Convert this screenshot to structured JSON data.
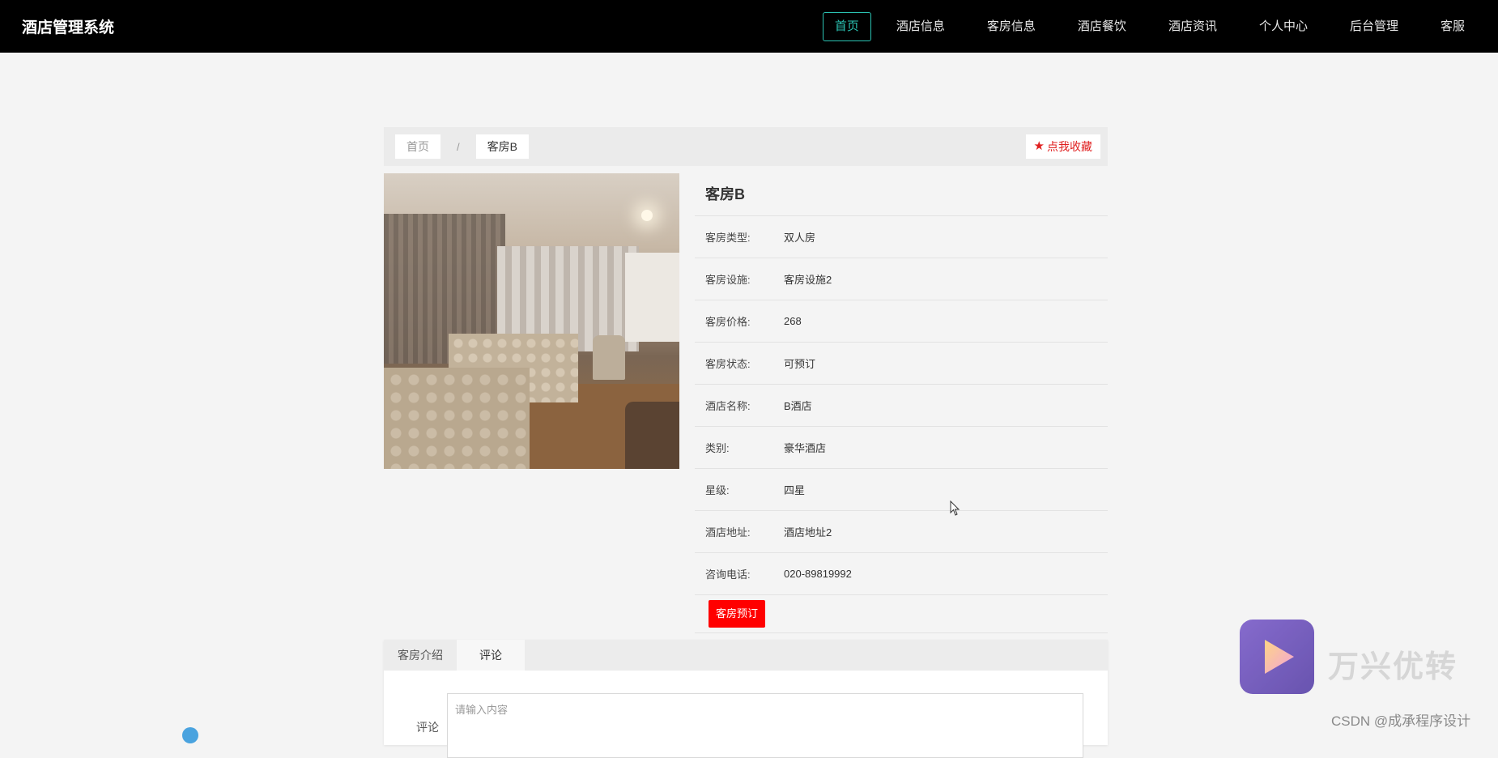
{
  "header": {
    "brand": "酒店管理系统",
    "nav": [
      {
        "label": "首页",
        "active": true
      },
      {
        "label": "酒店信息"
      },
      {
        "label": "客房信息"
      },
      {
        "label": "酒店餐饮"
      },
      {
        "label": "酒店资讯"
      },
      {
        "label": "个人中心"
      },
      {
        "label": "后台管理"
      },
      {
        "label": "客服"
      }
    ]
  },
  "breadcrumb": {
    "home": "首页",
    "separator": "/",
    "current": "客房B"
  },
  "favorite": {
    "label": "点我收藏",
    "icon": "star-icon",
    "color": "#e02020"
  },
  "room": {
    "title": "客房B",
    "fields": [
      {
        "label": "客房类型:",
        "value": "双人房"
      },
      {
        "label": "客房设施:",
        "value": "客房设施2"
      },
      {
        "label": "客房价格:",
        "value": "268"
      },
      {
        "label": "客房状态:",
        "value": "可预订"
      },
      {
        "label": "酒店名称:",
        "value": "B酒店"
      },
      {
        "label": "类别:",
        "value": "豪华酒店"
      },
      {
        "label": "星级:",
        "value": "四星"
      },
      {
        "label": "酒店地址:",
        "value": "酒店地址2"
      },
      {
        "label": "咨询电话:",
        "value": "020-89819992"
      }
    ],
    "book_button": "客房预订"
  },
  "tabs": [
    {
      "label": "客房介绍"
    },
    {
      "label": "评论",
      "active": true
    }
  ],
  "comment": {
    "label": "评论",
    "placeholder": "请输入内容"
  },
  "overlay": {
    "watermark_text": "万兴优转",
    "csdn": "CSDN @成承程序设计"
  },
  "colors": {
    "nav_active": "#2bc3b3",
    "book_button": "#ff0000",
    "topbar": "#000000"
  }
}
